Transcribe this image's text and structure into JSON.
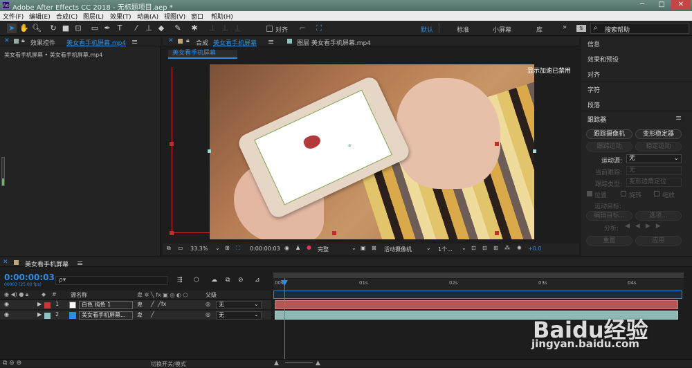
{
  "window": {
    "title": "Adobe After Effects CC 2018 - 无标题项目.aep *",
    "app_icon": "Ae"
  },
  "menu": [
    "文件(F)",
    "编辑(E)",
    "合成(C)",
    "图层(L)",
    "效果(T)",
    "动画(A)",
    "视图(V)",
    "窗口",
    "帮助(H)"
  ],
  "toolbar": {
    "snap_label": "对齐",
    "workspaces": [
      "默认",
      "标准",
      "小屏幕",
      "库"
    ],
    "search_placeholder": "搜索帮助"
  },
  "effects_panel": {
    "tab_prefix": "效果控件",
    "tab_name": "美女看手机屏幕.mp4",
    "breadcrumb": "美女看手机屏幕 • 美女看手机屏幕.mp4"
  },
  "comp_panel": {
    "tab_prefix": "合成",
    "tab_name": "美女看手机屏幕",
    "layer_tab": "图层 美女看手机屏幕.mp4",
    "sub_tab": "美女看手机屏幕",
    "gpu_note": "显示加速已禁用",
    "zoom": "33.3%",
    "timecode": "0:00:00:03",
    "resolution": "完整",
    "camera": "活动摄像机",
    "views": "1个...",
    "exposure": "+0.0"
  },
  "right_panel": {
    "items": [
      "信息",
      "效果和预设",
      "对齐",
      "字符",
      "段落"
    ],
    "tracker": {
      "title": "跟踪器",
      "btn_track_camera": "跟踪摄像机",
      "btn_warp_stabilizer": "变形稳定器",
      "btn_track_motion": "跟踪运动",
      "btn_stabilize": "稳定运动",
      "motion_source_label": "运动源:",
      "motion_source_value": "无",
      "current_track_label": "当前跟踪:",
      "current_track_value": "无",
      "track_type_label": "跟踪类型:",
      "track_type_value": "变形边角定位",
      "position": "位置",
      "rotation": "旋转",
      "scale": "缩放",
      "motion_target_label": "运动目标:",
      "edit_target": "编辑目标...",
      "options": "选项...",
      "analyze": "分析:",
      "reset": "重置",
      "apply": "应用"
    }
  },
  "timeline": {
    "tab_name": "美女看手机屏幕",
    "timecode": "0:00:00:03",
    "frame_info": "00003 (25.00 fps)",
    "search_placeholder": "ρ▾",
    "columns": {
      "source_name": "源名称",
      "parent": "父级"
    },
    "layers": [
      {
        "num": "1",
        "name": "白色 纯色 1",
        "parent": "无",
        "color": "#c23b3b",
        "bar_color": "#b45656"
      },
      {
        "num": "2",
        "name": "美女看手机屏幕...",
        "parent": "无",
        "color": "#8fc3c3",
        "bar_color": "#8fb7b3"
      }
    ],
    "ruler": [
      "00s",
      "01s",
      "02s",
      "03s",
      "04s"
    ],
    "footer": "切换开关/模式"
  },
  "watermark": {
    "logo": "Baidu经验",
    "url": "jingyan.baidu.com"
  },
  "colors": {
    "accent_blue": "#2f8ce0",
    "handle_red": "#c42c2c",
    "layer1": "#b45656",
    "layer2": "#8fb7b3"
  }
}
